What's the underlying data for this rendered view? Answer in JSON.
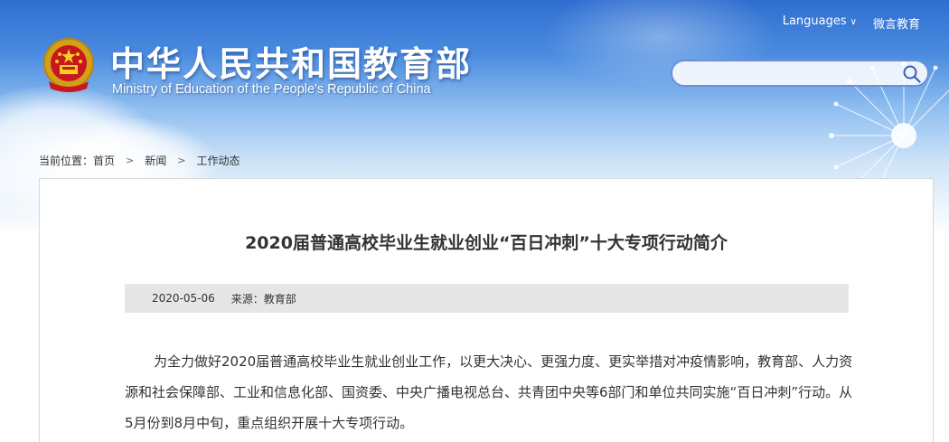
{
  "header": {
    "title_cn": "中华人民共和国教育部",
    "title_en": "Ministry of Education of the People's Republic of China",
    "links": {
      "languages": "Languages",
      "weiyan": "微言教育"
    },
    "search": {
      "placeholder": ""
    }
  },
  "breadcrumb": {
    "prefix": "当前位置：",
    "items": [
      "首页",
      "新闻",
      "工作动态"
    ],
    "separator": ">"
  },
  "article": {
    "title": "2020届普通高校毕业生就业创业“百日冲刺”十大专项行动简介",
    "date": "2020-05-06",
    "source": "来源：教育部",
    "body": "为全力做好2020届普通高校毕业生就业创业工作，以更大决心、更强力度、更实举措对冲疫情影响，教育部、人力资源和社会保障部、工业和信息化部、国资委、中央广播电视总台、共青团中央等6部门和单位共同实施“百日冲刺”行动。从5月份到8月中旬，重点组织开展十大专项行动。"
  },
  "icons": {
    "emblem": "national-emblem-icon",
    "search": "search-icon",
    "language_caret": "chevron-down-icon"
  },
  "colors": {
    "header_blue": "#2f6ed0",
    "search_border": "#6d8fd8",
    "meta_bar": "#e6e6e6",
    "text": "#333333"
  }
}
